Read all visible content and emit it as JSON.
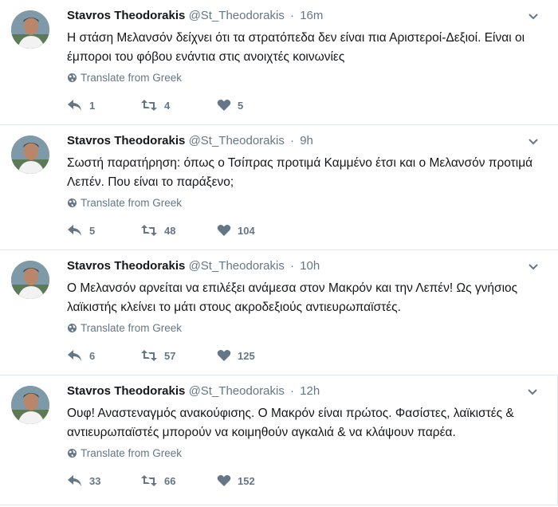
{
  "tweets": [
    {
      "name": "Stavros Theodorakis",
      "handle": "@St_Theodorakis",
      "time": "16m",
      "text": "Η στάση Μελανσόν δείχνει ότι τα στρατόπεδα δεν είναι πια Αριστεροί-Δεξιοί. Είναι οι έμποροι του φόβου ενάντια στις ανοιχτές κοινωνίες",
      "translate": "Translate from Greek",
      "replies": "1",
      "retweets": "4",
      "likes": "5"
    },
    {
      "name": "Stavros Theodorakis",
      "handle": "@St_Theodorakis",
      "time": "9h",
      "text": "Σωστή παρατήρηση: όπως ο Τσίπρας προτιμά Καμμένο έτσι και ο Μελανσόν προτιμά Λεπέν. Που είναι το παράξενο;",
      "translate": "Translate from Greek",
      "replies": "5",
      "retweets": "48",
      "likes": "104"
    },
    {
      "name": "Stavros Theodorakis",
      "handle": "@St_Theodorakis",
      "time": "10h",
      "text": "Ο Μελανσόν αρνείται να επιλέξει ανάμεσα στον Μακρόν και την Λεπέν! Ως γνήσιος λαϊκιστής κλείνει το μάτι στους ακροδεξιούς αντιευρωπαϊστές.",
      "translate": "Translate from Greek",
      "replies": "6",
      "retweets": "57",
      "likes": "125"
    },
    {
      "name": "Stavros Theodorakis",
      "handle": "@St_Theodorakis",
      "time": "12h",
      "text": "Ουφ! Αναστεναγμός ανακούφισης. Ο Μακρόν είναι πρώτος. Φασίστες, λαϊκιστές & αντιευρωπαϊστές μπορούν να κοιμηθούν αγκαλιά & να κλάψουν παρέα.",
      "translate": "Translate from Greek",
      "replies": "33",
      "retweets": "66",
      "likes": "152"
    }
  ],
  "icons": {
    "reply": "reply-icon",
    "retweet": "retweet-icon",
    "like": "heart-icon",
    "caret": "chevron-down-icon",
    "globe": "globe-icon"
  },
  "colors": {
    "icon": "#657786",
    "text": "#14171a",
    "muted": "#657786",
    "border": "#e1e8ed"
  }
}
